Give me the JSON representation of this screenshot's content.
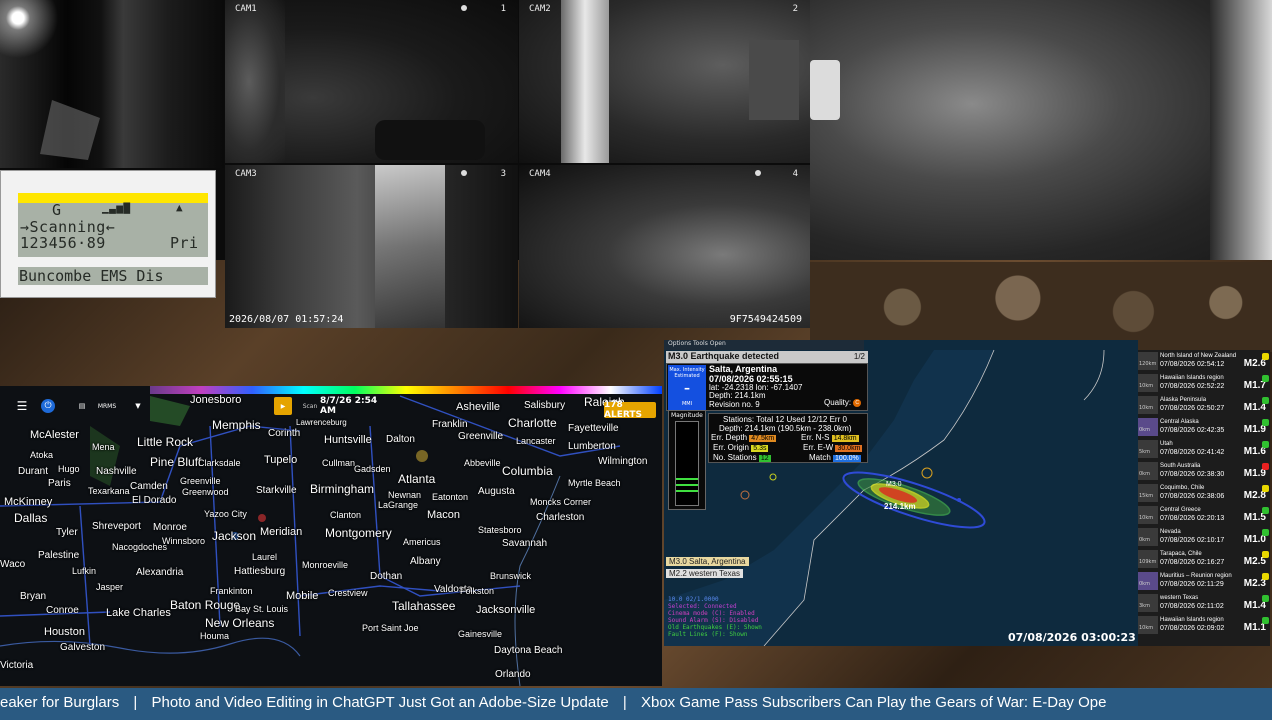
{
  "cameras": {
    "cam1": {
      "label": "CAM1",
      "number": "1"
    },
    "cam2": {
      "label": "CAM2",
      "number": "2"
    },
    "cam3": {
      "label": "CAM3",
      "number": "3"
    },
    "cam4": {
      "label": "CAM4",
      "number": "4"
    },
    "timestamp": "2026/08/07  01:57:24",
    "serial": "9F7549424509"
  },
  "scanner": {
    "line1": "G",
    "line2": "→Scanning←",
    "line3": "123456·89",
    "line3_right": "Pri",
    "line4": "Buncombe EMS Dis"
  },
  "radar": {
    "source": "MRMS",
    "scan_time": "8/7/26  2:54 AM",
    "scan_label": "Scan",
    "alerts": "178 ALERTS",
    "cities": [
      {
        "name": "Jonesboro"
      },
      {
        "name": "Memphis"
      },
      {
        "name": "Little Rock"
      },
      {
        "name": "McAlester"
      },
      {
        "name": "Mena"
      },
      {
        "name": "Atoka"
      },
      {
        "name": "Durant"
      },
      {
        "name": "Hugo"
      },
      {
        "name": "Paris"
      },
      {
        "name": "McKinney"
      },
      {
        "name": "Dallas"
      },
      {
        "name": "Tyler"
      },
      {
        "name": "Palestine"
      },
      {
        "name": "Waco"
      },
      {
        "name": "Bryan"
      },
      {
        "name": "Conroe"
      },
      {
        "name": "Houston"
      },
      {
        "name": "Galveston"
      },
      {
        "name": "Victoria"
      },
      {
        "name": "Lufkin"
      },
      {
        "name": "Jasper"
      },
      {
        "name": "Nacogdoches"
      },
      {
        "name": "Shreveport"
      },
      {
        "name": "Texarkana"
      },
      {
        "name": "Nashville"
      },
      {
        "name": "Camden"
      },
      {
        "name": "El Dorado"
      },
      {
        "name": "Monroe"
      },
      {
        "name": "Winnsboro"
      },
      {
        "name": "Alexandria"
      },
      {
        "name": "Lake Charles"
      },
      {
        "name": "Baton Rouge"
      },
      {
        "name": "Houma"
      },
      {
        "name": "New Orleans"
      },
      {
        "name": "Bay St. Louis"
      },
      {
        "name": "Hattiesburg"
      },
      {
        "name": "Laurel"
      },
      {
        "name": "Jackson"
      },
      {
        "name": "Yazoo City"
      },
      {
        "name": "Greenwood"
      },
      {
        "name": "Greenville"
      },
      {
        "name": "Pine Bluff"
      },
      {
        "name": "Clarksdale"
      },
      {
        "name": "Corinth"
      },
      {
        "name": "Tupelo"
      },
      {
        "name": "Starkville"
      },
      {
        "name": "Meridian"
      },
      {
        "name": "Huntsville"
      },
      {
        "name": "Cullman"
      },
      {
        "name": "Birmingham"
      },
      {
        "name": "Montgomery"
      },
      {
        "name": "Frankinton"
      },
      {
        "name": "Mobile"
      },
      {
        "name": "Crestview"
      },
      {
        "name": "Dothan"
      },
      {
        "name": "Monroeville"
      },
      {
        "name": "Tallahassee"
      },
      {
        "name": "Port Saint Joe"
      },
      {
        "name": "Valdosta"
      },
      {
        "name": "Albany"
      },
      {
        "name": "Americus"
      },
      {
        "name": "Macon"
      },
      {
        "name": "Atlanta"
      },
      {
        "name": "LaGrange"
      },
      {
        "name": "Newnan"
      },
      {
        "name": "Eatonton"
      },
      {
        "name": "Dalton"
      },
      {
        "name": "Franklin"
      },
      {
        "name": "Greenville"
      },
      {
        "name": "Asheville"
      },
      {
        "name": "Salisbury"
      },
      {
        "name": "Raleigh"
      },
      {
        "name": "Charlotte"
      },
      {
        "name": "Lancaster"
      },
      {
        "name": "Fayetteville"
      },
      {
        "name": "Lumberton"
      },
      {
        "name": "Wilmington"
      },
      {
        "name": "Columbia"
      },
      {
        "name": "Abbeville"
      },
      {
        "name": "Augusta"
      },
      {
        "name": "Myrtle Beach"
      },
      {
        "name": "Moncks Corner"
      },
      {
        "name": "Charleston"
      },
      {
        "name": "Statesboro"
      },
      {
        "name": "Savannah"
      },
      {
        "name": "Brunswick"
      },
      {
        "name": "Folkston"
      },
      {
        "name": "Jacksonville"
      },
      {
        "name": "Gainesville"
      },
      {
        "name": "Daytona Beach"
      },
      {
        "name": "Orlando"
      },
      {
        "name": "Clanton"
      },
      {
        "name": "Gadsden"
      },
      {
        "name": "Lawrenceburg"
      }
    ]
  },
  "earthquake": {
    "menu": "Options  Tools  Open",
    "header": "M3.0 Earthquake detected",
    "count": "1/2",
    "intensity_label": "Max. Intensity Estimated",
    "intensity_unit": "MMI",
    "location": "Salta, Argentina",
    "datetime": "07/08/2026 02:55:15",
    "coords": "lat: -24.2318 lon: -67.1407",
    "depth": "Depth: 214.1km",
    "revision": "Revision no. 9",
    "quality_label": "Quality:",
    "quality_value": "C",
    "magnitude_label": "Magnitude",
    "stations": "Stations: Total 12 Used 12/12 Err 0",
    "depth_detail": "Depth: 214.1km (190.5km - 238.0km)",
    "err_depth_label": "Err. Depth",
    "err_depth": "47.5km",
    "err_ns_label": "Err. N-S",
    "err_ns": "14.8km",
    "err_origin_label": "Err. Origin",
    "err_origin": "5.3s",
    "err_ew_label": "Err. E-W",
    "err_ew": "30.0km",
    "no_stations_label": "No. Stations",
    "no_stations": "12",
    "match_label": "Match",
    "match": "100.0%",
    "map_mag": "M3.0",
    "map_depth": "214.1km",
    "tag1": "M3.0 Salta, Argentina",
    "tag2": "M2.2 western Texas",
    "time": "07/08/2026 03:00:23",
    "legend": [
      "10.0 02/1.0000",
      "Selected: Connected",
      "Cinema mode (C): Enabled",
      "Sound Alarm (S): Disabled",
      "Old Earthquakes (E): Shown",
      "Fault Lines (F): Shown"
    ]
  },
  "quake_list": [
    {
      "depth": "120km",
      "region": "North Island of New Zealand",
      "date": "07/08/2026 02:54:12",
      "mag": "M2.6",
      "color": "#e8d800"
    },
    {
      "depth": "10km",
      "region": "Hawaiian Islands region",
      "date": "07/08/2026 02:52:22",
      "mag": "M1.7",
      "color": "#30c030"
    },
    {
      "depth": "10km",
      "region": "Alaska Peninsula",
      "date": "07/08/2026 02:50:27",
      "mag": "M1.4",
      "color": "#30c030"
    },
    {
      "depth": "0km",
      "region": "Central Alaska",
      "date": "07/08/2026 02:42:35",
      "mag": "M1.9",
      "color": "#30c030"
    },
    {
      "depth": "5km",
      "region": "Utah",
      "date": "07/08/2026 02:41:42",
      "mag": "M1.6",
      "color": "#30c030"
    },
    {
      "depth": "0km",
      "region": "South Australia",
      "date": "07/08/2026 02:38:30",
      "mag": "M1.9",
      "color": "#e82020"
    },
    {
      "depth": "15km",
      "region": "Coquimbo, Chile",
      "date": "07/08/2026 02:38:06",
      "mag": "M2.8",
      "color": "#e8d800"
    },
    {
      "depth": "10km",
      "region": "Central Greece",
      "date": "07/08/2026 02:20:13",
      "mag": "M1.5",
      "color": "#30c030"
    },
    {
      "depth": "0km",
      "region": "Nevada",
      "date": "07/08/2026 02:10:17",
      "mag": "M1.0",
      "color": "#30c030"
    },
    {
      "depth": "109km",
      "region": "Tarapaca, Chile",
      "date": "07/08/2026 02:16:27",
      "mag": "M2.5",
      "color": "#e8d800"
    },
    {
      "depth": "0km",
      "region": "Mauritius – Reunion region",
      "date": "07/08/2026 02:11:29",
      "mag": "M2.3",
      "color": "#e8d800"
    },
    {
      "depth": "3km",
      "region": "western Texas",
      "date": "07/08/2026 02:11:02",
      "mag": "M1.4",
      "color": "#30c030"
    },
    {
      "depth": "10km",
      "region": "Hawaiian Islands region",
      "date": "07/08/2026 02:09:02",
      "mag": "M1.1",
      "color": "#30c030"
    }
  ],
  "ticker": {
    "items": [
      "eaker for Burglars",
      "Photo and Video Editing in ChatGPT Just Got an Adobe-Size Update",
      "Xbox Game Pass Subscribers Can Play the Gears of War: E-Day Ope"
    ],
    "separator": "|"
  },
  "colors": {
    "ticker_bg": "#2a5a82",
    "alerts_badge": "#e5a400",
    "eq_water": "#0e2a3e",
    "intensity_blue": "#1450e0",
    "scanner_yellow": "#ffe600",
    "lcd_green": "#a8b1a6"
  }
}
